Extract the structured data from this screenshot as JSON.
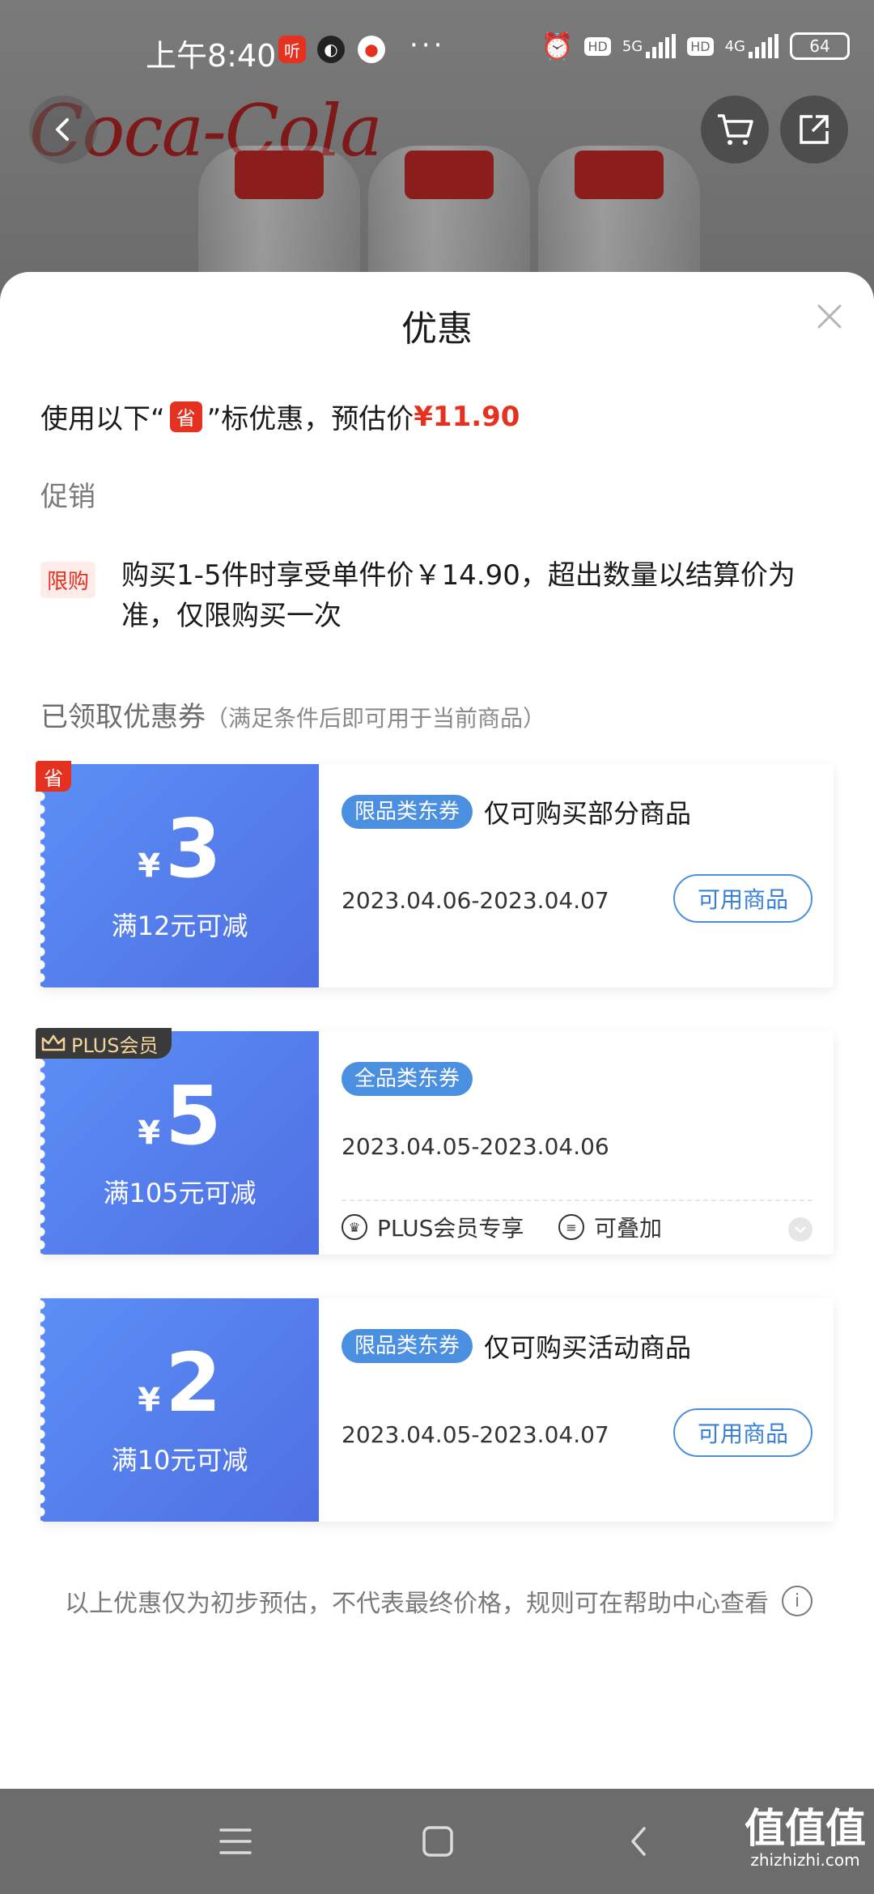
{
  "status_bar": {
    "time": "上午8:40",
    "app_badge_1": "听",
    "more": "···",
    "network_1": "5G",
    "network_2": "4G",
    "hd": "HD",
    "battery": "64"
  },
  "header": {
    "brand_logo_text": "Coca-Cola"
  },
  "sheet": {
    "title": "优惠",
    "summary_prefix": "使用以下“",
    "summary_badge": "省",
    "summary_suffix": "”标优惠，预估价",
    "summary_price": "¥11.90",
    "promo_label": "促销",
    "limit_badge": "限购",
    "limit_text": "购买1-5件时享受单件价￥14.90，超出数量以结算价为准，仅限购买一次",
    "coupons_title": "已领取优惠券",
    "coupons_subtitle": "（满足条件后即可用于当前商品）",
    "footnote": "以上优惠仅为初步预估，不代表最终价格，规则可在帮助中心查看"
  },
  "coupons": [
    {
      "corner": "省",
      "yen": "¥",
      "amount": "3",
      "condition": "满12元可减",
      "tag": "限品类东券",
      "desc": "仅可购买部分商品",
      "dates": "2023.04.06-2023.04.07",
      "button": "可用商品"
    },
    {
      "corner": "PLUS会员",
      "yen": "¥",
      "amount": "5",
      "condition": "满105元可减",
      "tag": "全品类东券",
      "dates": "2023.04.05-2023.04.06",
      "feature_1": "PLUS会员专享",
      "feature_2": "可叠加"
    },
    {
      "yen": "¥",
      "amount": "2",
      "condition": "满10元可减",
      "tag": "限品类东券",
      "desc": "仅可购买活动商品",
      "dates": "2023.04.05-2023.04.07",
      "button": "可用商品"
    }
  ],
  "watermark": {
    "main": "值值值",
    "sub": "zhizhizhi.com"
  },
  "colors": {
    "accent_red": "#e5311f",
    "coupon_blue": "#4f6fe3",
    "tag_blue": "#4a8fe0"
  }
}
